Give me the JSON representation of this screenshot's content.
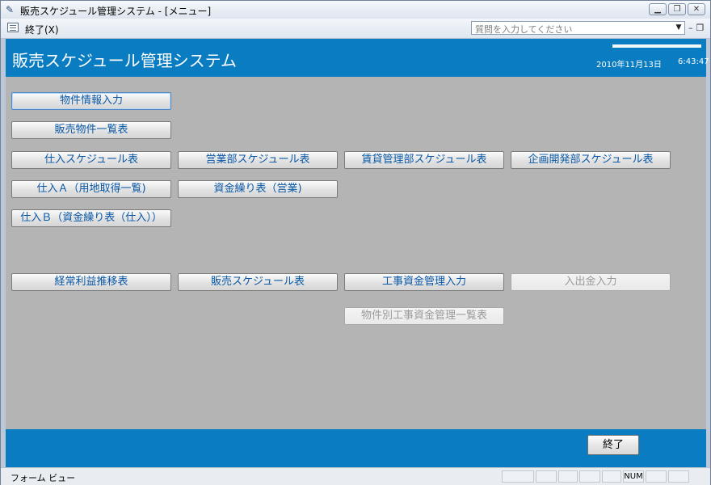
{
  "window": {
    "title": "販売スケジュール管理システム - [メニュー]",
    "icon": "pencil-icon"
  },
  "menubar": {
    "exit_label": "終了(X)",
    "help_placeholder": "質問を入力してください"
  },
  "header": {
    "app_title": "販売スケジュール管理システム",
    "date": "2010年11月13日",
    "time": "6:43:47"
  },
  "buttons": {
    "property_info_input": "物件情報入力",
    "sales_property_list": "販売物件一覧表",
    "purchase_schedule": "仕入スケジュール表",
    "sales_dept_schedule": "営業部スケジュール表",
    "rental_dept_schedule": "賃貸管理部スケジュール表",
    "planning_dept_schedule": "企画開発部スケジュール表",
    "purchase_a": "仕入Ａ（用地取得一覧)",
    "cash_flow_sales": "資金繰り表（営業)",
    "purchase_b": "仕入Ｂ（資金繰り表（仕入））",
    "ordinary_profit": "経常利益推移表",
    "sales_schedule": "販売スケジュール表",
    "construction_funds_input": "工事資金管理入力",
    "payment_input": "入出金入力",
    "construction_funds_list": "物件別工事資金管理一覧表"
  },
  "footer": {
    "exit_button": "終了"
  },
  "statusbar": {
    "view_label": "フォーム ビュー",
    "num_indicator": "NUM"
  },
  "colors": {
    "header_blue": "#0a7cc1",
    "button_text": "#0a58a6"
  }
}
